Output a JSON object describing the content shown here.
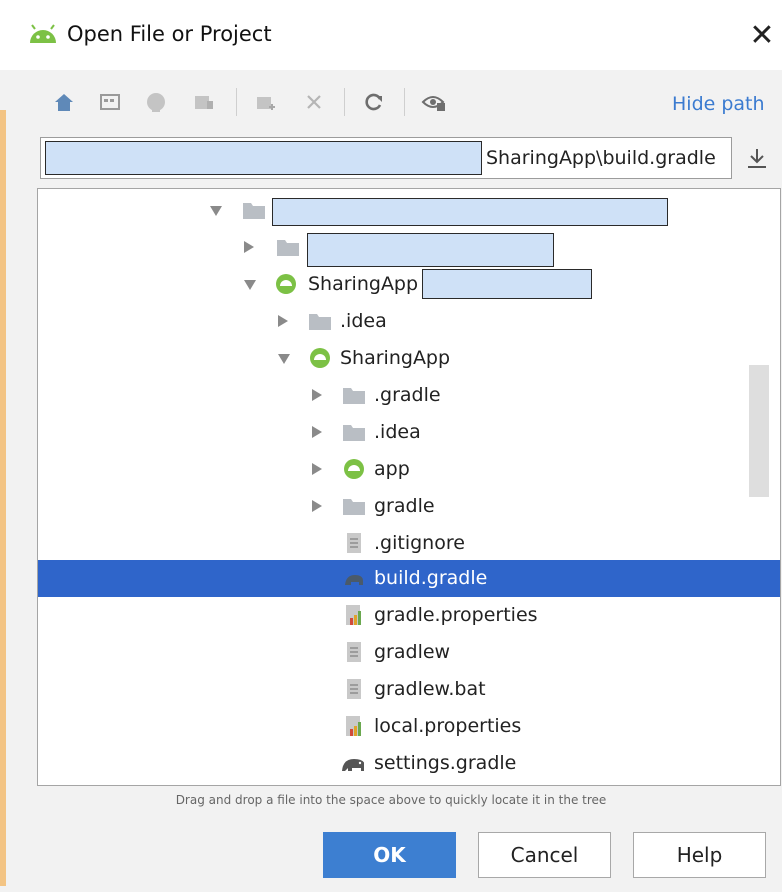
{
  "window": {
    "title": "Open File or Project",
    "close_glyph": "✕"
  },
  "toolbar": {
    "hide_path_label": "Hide path",
    "icons": [
      "home-icon",
      "desktop-icon",
      "project-icon",
      "module-icon",
      "new-folder-icon",
      "delete-icon",
      "refresh-icon",
      "show-hidden-icon"
    ]
  },
  "path": {
    "visible_text": "SharingApp\\build.gradle"
  },
  "tree": {
    "items": [
      {
        "label": "",
        "redacted": true,
        "type": "folder",
        "state": "expanded"
      },
      {
        "label": "",
        "redacted": true,
        "type": "folder",
        "state": "collapsed"
      },
      {
        "label": "SharingApp",
        "redacted_suffix": true,
        "type": "module",
        "state": "expanded"
      },
      {
        "label": ".idea",
        "type": "folder",
        "state": "collapsed"
      },
      {
        "label": "SharingApp",
        "type": "module",
        "state": "expanded"
      },
      {
        "label": ".gradle",
        "type": "folder",
        "state": "collapsed"
      },
      {
        "label": ".idea",
        "type": "folder",
        "state": "collapsed"
      },
      {
        "label": "app",
        "type": "module",
        "state": "collapsed"
      },
      {
        "label": "gradle",
        "type": "folder",
        "state": "collapsed"
      },
      {
        "label": ".gitignore",
        "type": "text-file"
      },
      {
        "label": "build.gradle",
        "type": "gradle-file",
        "selected": true
      },
      {
        "label": "gradle.properties",
        "type": "properties-file"
      },
      {
        "label": "gradlew",
        "type": "text-file"
      },
      {
        "label": "gradlew.bat",
        "type": "text-file"
      },
      {
        "label": "local.properties",
        "type": "properties-file"
      },
      {
        "label": "settings.gradle",
        "type": "gradle-settings-file"
      }
    ]
  },
  "hint": "Drag and drop a file into the space above to quickly locate it in the tree",
  "buttons": {
    "ok": "OK",
    "cancel": "Cancel",
    "help": "Help"
  },
  "colors": {
    "selection": "#2f65ca",
    "link": "#3b7bd0",
    "primary_button": "#3d7fd1",
    "android_green": "#7cc145"
  }
}
